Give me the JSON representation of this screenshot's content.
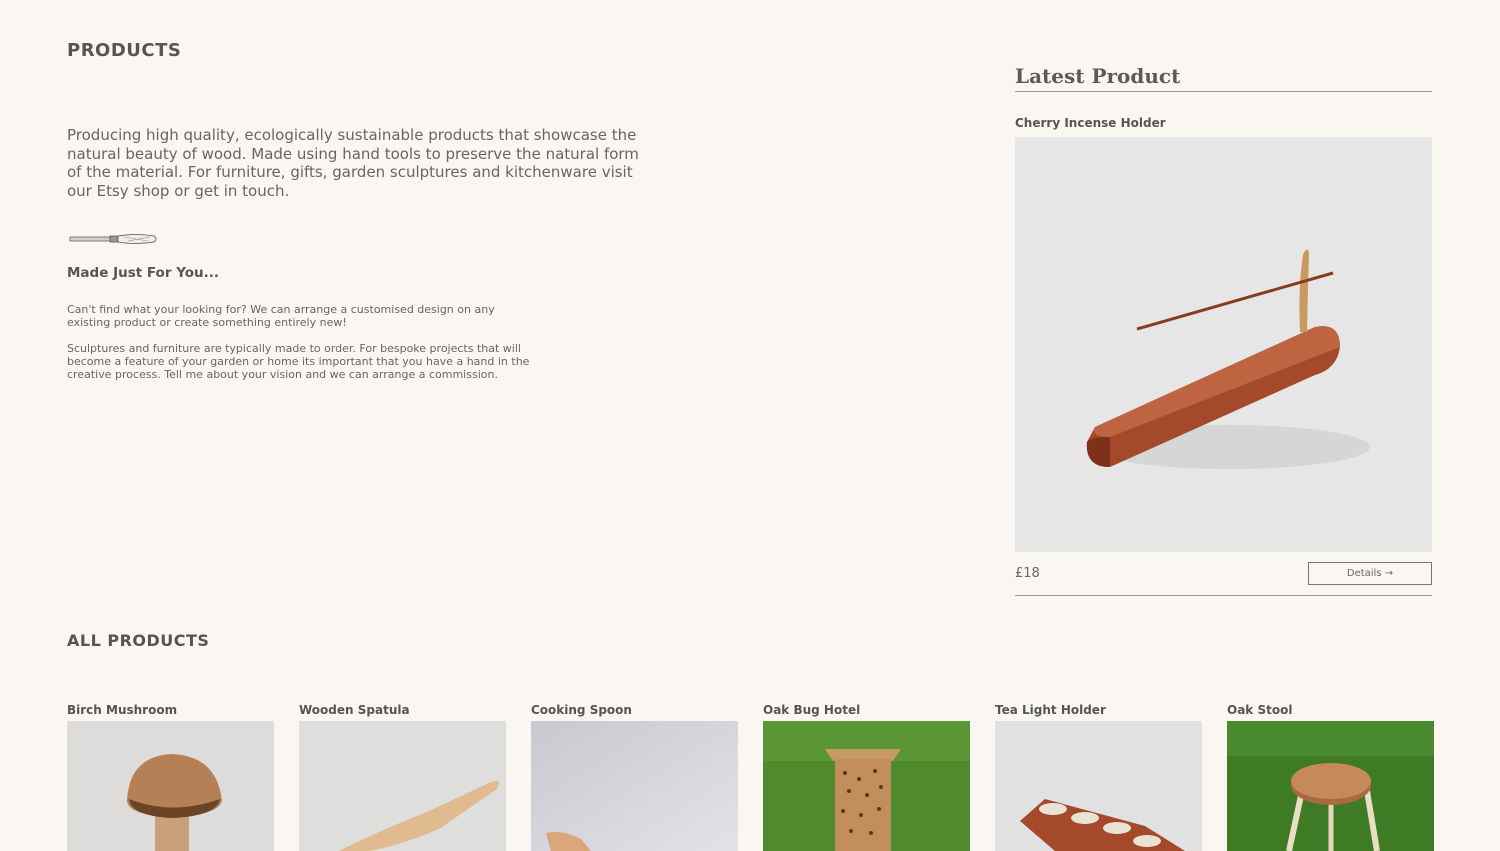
{
  "page": {
    "title": "PRODUCTS",
    "intro": "Producing high quality, ecologically sustainable products that showcase the natural beauty of wood. Made using hand tools to preserve the natural form of the material. For furniture, gifts, garden sculptures and kitchenware visit our Etsy shop or get in touch.",
    "subheading": "Made Just For You...",
    "paragraph1": "Can't find what your looking for? We can arrange a customised design on any existing product or create something entirely new!",
    "paragraph2": "Sculptures and furniture are typically made to order. For bespoke projects that will become a feature of your garden or home its important that you have a hand in the creative process. Tell me about your vision and we can arrange a commission."
  },
  "latest": {
    "heading": "Latest Product",
    "name": "Cherry Incense Holder",
    "price": "£18",
    "details_label": "Details →"
  },
  "all_products": {
    "heading": "ALL PRODUCTS",
    "items": [
      {
        "name": "Birch Mushroom"
      },
      {
        "name": "Wooden Spatula"
      },
      {
        "name": "Cooking Spoon"
      },
      {
        "name": "Oak Bug Hotel"
      },
      {
        "name": "Tea Light Holder"
      },
      {
        "name": "Oak Stool"
      }
    ]
  },
  "colors": {
    "background": "#faf7f3",
    "text": "#555555",
    "wood": "#a4492a",
    "grass": "#4f8a2c"
  }
}
